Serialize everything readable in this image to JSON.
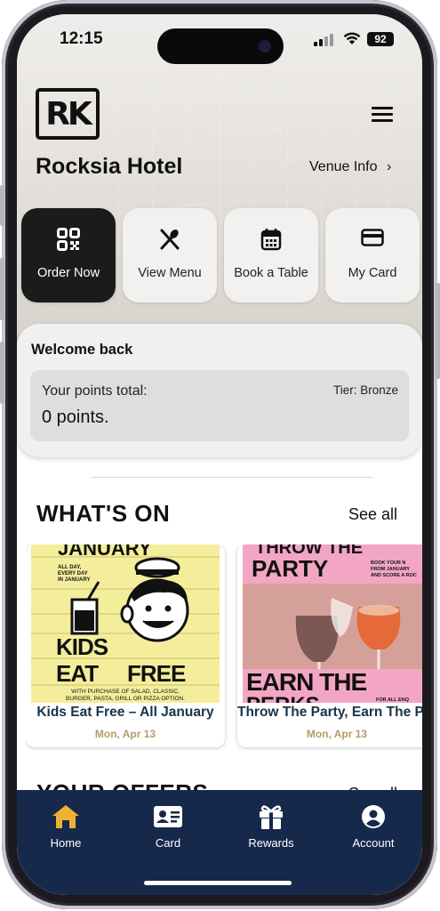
{
  "status_bar": {
    "time": "12:15",
    "battery": "92"
  },
  "header": {
    "logo_text": "RK",
    "venue_name": "Rocksia Hotel",
    "venue_info_label": "Venue Info",
    "venue_info_chevron": "›"
  },
  "quick_actions": [
    {
      "label": "Order Now",
      "icon": "qr-code-icon"
    },
    {
      "label": "View Menu",
      "icon": "utensils-icon"
    },
    {
      "label": "Book a Table",
      "icon": "calendar-icon"
    },
    {
      "label": "My Card",
      "icon": "credit-card-icon"
    }
  ],
  "welcome": {
    "title": "Welcome back",
    "points_label": "Your points total:",
    "points_value": "0 points.",
    "tier": "Tier: Bronze"
  },
  "whats_on": {
    "title": "WHAT'S ON",
    "see_all": "See all",
    "events": [
      {
        "title": "Kids Eat Free – All January",
        "date": "Mon, Apr 13",
        "poster": {
          "top": "JANUARY",
          "small": [
            "ALL DAY,",
            "EVERY DAY",
            "IN JANUARY"
          ],
          "headline_1": "KIDS",
          "headline_2a": "EAT",
          "headline_2b": "FREE",
          "fine_print_1": "WITH PURCHASE OF SALAD, CLASSIC,",
          "fine_print_2": "BURGER, PASTA, GRILL OR PIZZA OPTION."
        }
      },
      {
        "title": "Throw The Party, Earn The Perks",
        "date": "Mon, Apr 13",
        "poster": {
          "top": "THROW THE",
          "headline": "PARTY",
          "side_text": [
            "BOOK YOUR N",
            "FROM JANUARY",
            "AND SCORE A ROC"
          ],
          "headline_2": "EARN THE",
          "headline_3": "PERKS",
          "fine_print": "FOR ALL ENQ"
        }
      }
    ]
  },
  "offers": {
    "title": "YOUR OFFERS",
    "see_all": "See all"
  },
  "tabbar": [
    {
      "label": "Home",
      "icon": "home-icon",
      "active": true
    },
    {
      "label": "Card",
      "icon": "id-card-icon",
      "active": false
    },
    {
      "label": "Rewards",
      "icon": "gift-icon",
      "active": false
    },
    {
      "label": "Account",
      "icon": "user-circle-icon",
      "active": false
    }
  ],
  "colors": {
    "tabbar_bg": "#17294b",
    "home_active": "#f0b132",
    "event_title": "#16344a",
    "event_date": "#b79a6b",
    "primary_action_bg": "#1b1b1b"
  }
}
